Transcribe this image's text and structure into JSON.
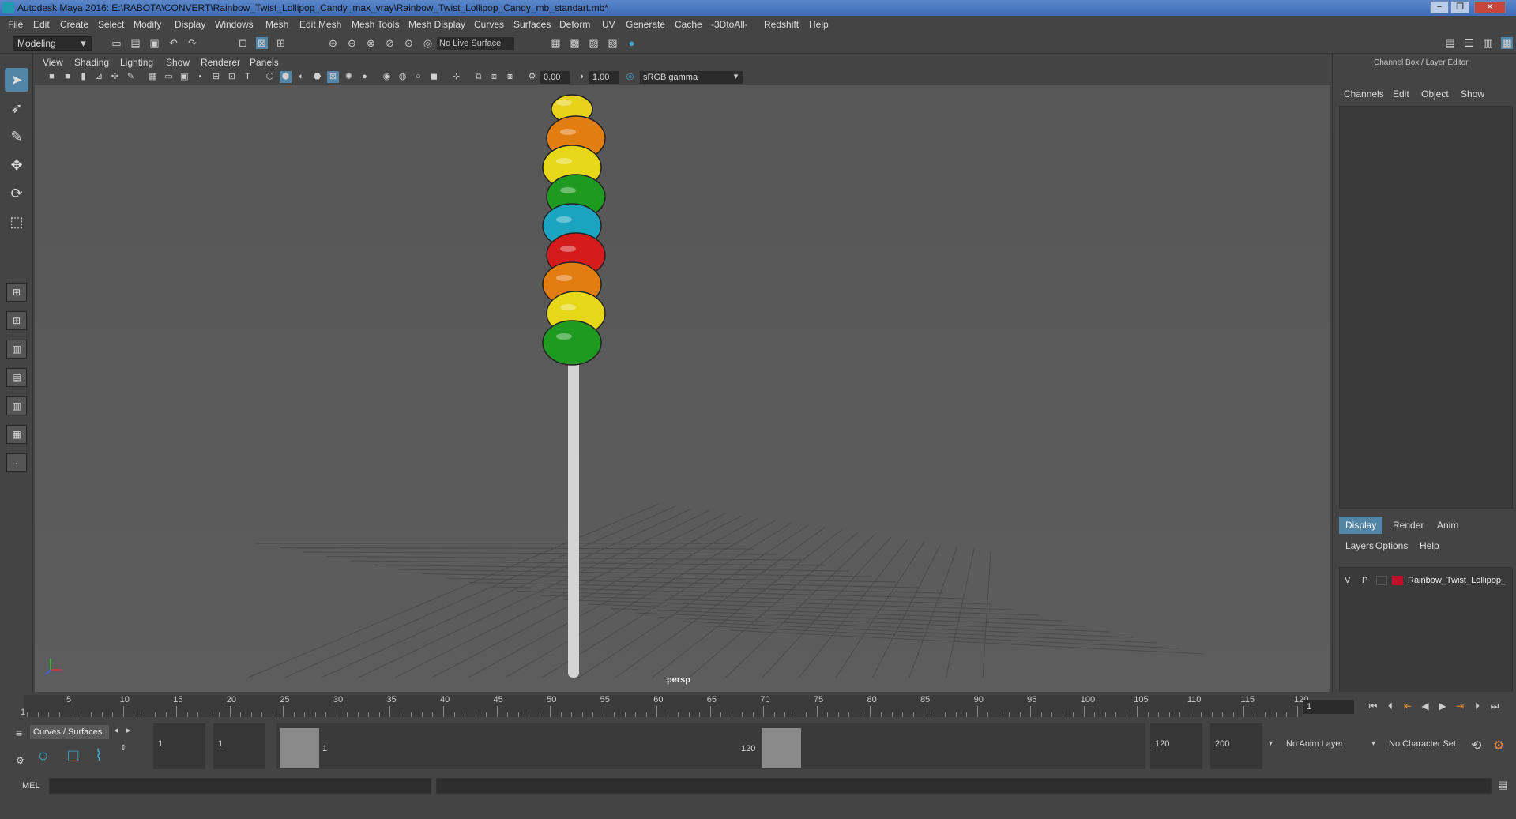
{
  "window": {
    "title": "Autodesk Maya 2016: E:\\RABOTA\\CONVERT\\Rainbow_Twist_Lollipop_Candy_max_vray\\Rainbow_Twist_Lollipop_Candy_mb_standart.mb*",
    "minimize": "−",
    "maximize": "❐",
    "close": "✕"
  },
  "menubar": [
    "File",
    "Edit",
    "Create",
    "Select",
    "Modify",
    "Display",
    "Windows",
    "Mesh",
    "Edit Mesh",
    "Mesh Tools",
    "Mesh Display",
    "Curves",
    "Surfaces",
    "Deform",
    "UV",
    "Generate",
    "Cache",
    "-3DtoAll-",
    "Redshift",
    "Help"
  ],
  "shelf": {
    "mode": "Modeling",
    "live_surface": "No Live Surface"
  },
  "viewport": {
    "menus": [
      "View",
      "Shading",
      "Lighting",
      "Show",
      "Renderer",
      "Panels"
    ],
    "exposure": "0.00",
    "gamma": "1.00",
    "color_space": "sRGB gamma",
    "camera_label": "persp",
    "candy_colors": [
      "#e8d21a",
      "#e27d12",
      "#e6d818",
      "#1f9a21",
      "#1aa4c0",
      "#d41c1c",
      "#e27d12",
      "#e6d818",
      "#1f9a21"
    ]
  },
  "right_panel": {
    "title": "Channel Box / Layer Editor",
    "tabs": [
      "Channels",
      "Edit",
      "Object",
      "Show"
    ],
    "layer_tabs": [
      "Display",
      "Render",
      "Anim"
    ],
    "layer_menus": [
      "Layers",
      "Options",
      "Help"
    ],
    "layer": {
      "v": "V",
      "p": "P",
      "name": "Rainbow_Twist_Lollipop_",
      "color": "#c0102a"
    }
  },
  "timeline": {
    "ticks": [
      "5",
      "10",
      "15",
      "20",
      "25",
      "30",
      "35",
      "40",
      "45",
      "50",
      "55",
      "60",
      "65",
      "70",
      "75",
      "80",
      "85",
      "90",
      "95",
      "100",
      "105",
      "110",
      "115",
      "120"
    ],
    "start_marker": "1",
    "current_frame": "1"
  },
  "range": {
    "shelf_tab": "Curves / Surfaces",
    "start": "1",
    "playback_start": "1",
    "slider_start": "1",
    "slider_end": "120",
    "playback_end": "120",
    "end": "200",
    "anim_layer": "No Anim Layer",
    "character_set": "No Character Set"
  },
  "cmdline": {
    "label": "MEL"
  }
}
